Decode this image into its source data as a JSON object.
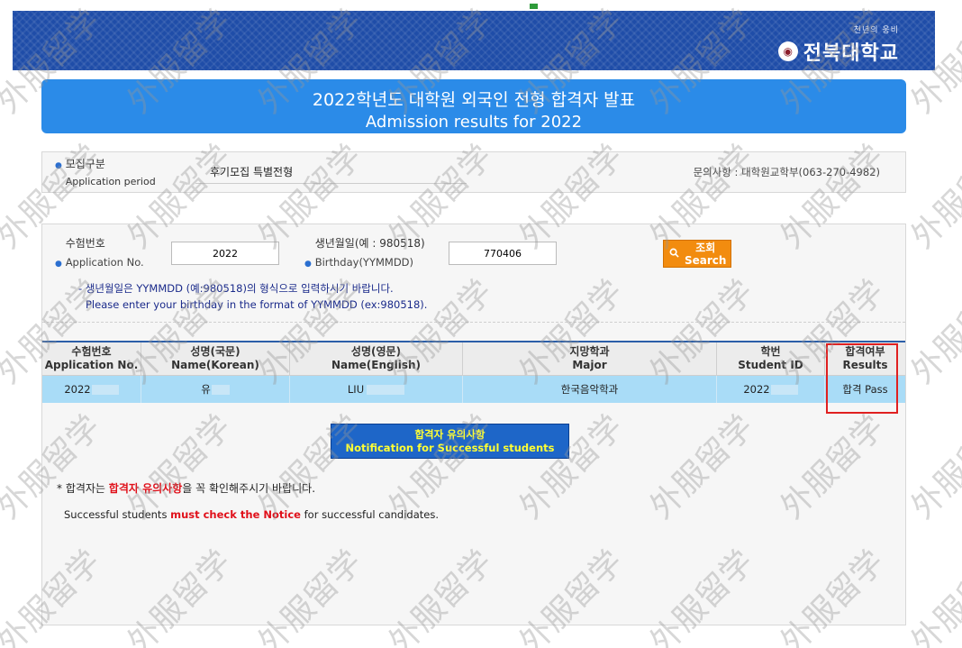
{
  "header": {
    "slogan": "천년의 웅비",
    "university_name": "전북대학교",
    "emblem_icon": "university-emblem-icon"
  },
  "title": {
    "korean": "2022학년도 대학원 외국인 전형 합격자 발표",
    "english": "Admission results for 2022"
  },
  "period": {
    "label_ko": "모집구분",
    "label_en": "Application period",
    "value": "후기모집 특별전형",
    "contact": "문의사항 : 대학원교학부(063-270-4982)"
  },
  "search": {
    "app_no_label_ko": "수험번호",
    "app_no_label_en": "Application No.",
    "app_no_value": "2022",
    "birth_label_ko": "생년월일(예 : 980518)",
    "birth_label_en": "Birthday(YYMMDD)",
    "birth_value": "770406",
    "button_ko": "조회",
    "button_en": "Search",
    "button_icon": "search-icon",
    "hint_ko": "- 생년월일은 YYMMDD (예:980518)의 형식으로 입력하시기 바랍니다.",
    "hint_en": "Please enter your birthday in the format of YYMMDD (ex:980518)."
  },
  "table": {
    "headers": [
      {
        "ko": "수험번호",
        "en": "Application No."
      },
      {
        "ko": "성명(국문)",
        "en": "Name(Korean)"
      },
      {
        "ko": "성명(영문)",
        "en": "Name(English)"
      },
      {
        "ko": "지망학과",
        "en": "Major"
      },
      {
        "ko": "학번",
        "en": "Student ID"
      },
      {
        "ko": "합격여부",
        "en": "Results"
      }
    ],
    "row": {
      "application_no": "2022",
      "name_korean": "유",
      "name_english": "LIU",
      "major": "한국음악학과",
      "student_id": "2022",
      "result": "합격 Pass"
    }
  },
  "notice": {
    "button_ko": "합격자 유의사항",
    "button_en": "Notification for Successful students",
    "note_ko_prefix": "* 합격자는 ",
    "note_ko_highlight": "합격자 유의사항",
    "note_ko_suffix": "을 꼭 확인해주시기 바랍니다.",
    "note_en_prefix": "Successful students ",
    "note_en_highlight": "must check the Notice",
    "note_en_suffix": " for successful candidates."
  },
  "watermark_text": "外服留学",
  "colors": {
    "header_blue": "#1f4da8",
    "title_blue": "#2b8be8",
    "search_orange": "#f28c0f",
    "row_highlight": "#a9dcf7",
    "notice_text_yellow": "#ffff33",
    "alert_red": "#e0101a"
  }
}
